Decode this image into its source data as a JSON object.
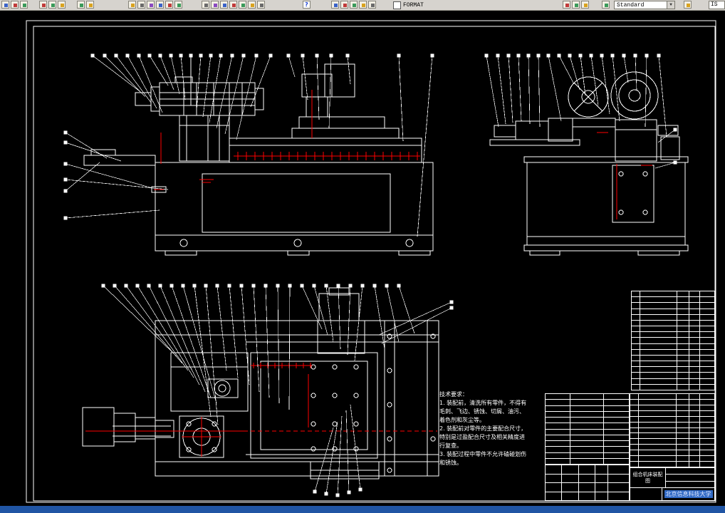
{
  "toolbar": {
    "groups": [
      {
        "icons": [
          "new-file",
          "open-file",
          "save"
        ]
      },
      {
        "icons": [
          "plot",
          "print-preview",
          "publish"
        ]
      },
      {
        "icons": [
          "undo",
          "redo"
        ]
      },
      {
        "icons": [
          "pan",
          "zoom-realtime",
          "zoom-window",
          "zoom-dynamic",
          "zoom-scale",
          "zoom-previous"
        ]
      },
      {
        "icons": [
          "cut",
          "copy",
          "paste",
          "match-properties",
          "properties",
          "design-center",
          "tool-palettes"
        ]
      },
      {
        "icons": [
          "help"
        ]
      },
      {
        "icons": [
          "layer-properties",
          "layer-states",
          "layer-current",
          "layer-previous",
          "linetype"
        ]
      },
      {
        "icons": [
          "object-color",
          "linetype-control",
          "lineweight-control"
        ]
      },
      {
        "icons": [
          "text-style"
        ]
      },
      {
        "icons": [
          "dim-style"
        ]
      }
    ],
    "format_label": "FORMAT",
    "style_value": "Standard",
    "dim_style_partial": "IS"
  },
  "drawing": {
    "line_color": "#ffffff",
    "dimension_color": "#ff0000",
    "background": "#000000"
  },
  "tech_requirements": {
    "title": "技术要求：",
    "items": [
      "1. 装配前，清洗所有零件，不得有",
      "毛刺、飞边、锈蚀、切屑、油污、",
      "着色剂和灰尘等。",
      "2. 装配前对零件的主要配合尺寸，",
      "特别是过盈配合尺寸及相关精度进",
      "行复查。",
      "3. 装配过程中零件不允许磕碰划伤",
      "和锈蚀。"
    ]
  },
  "title_block": {
    "drawing_title": "组合机床装配图",
    "organization": "北京信息科技大学"
  }
}
